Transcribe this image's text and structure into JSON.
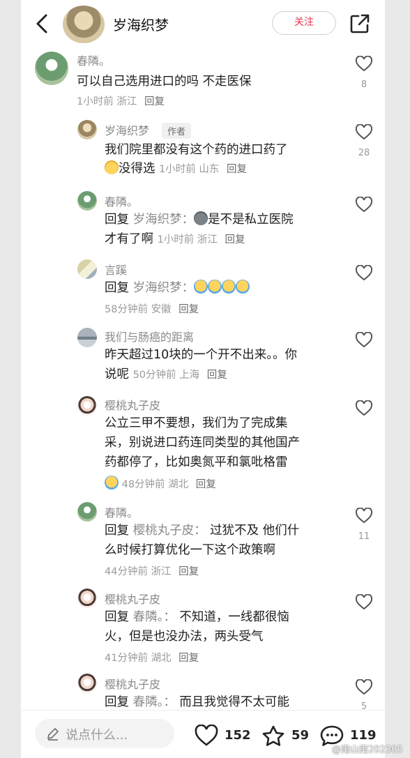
{
  "header": {
    "title": "岁海织梦",
    "follow_label": "关注"
  },
  "comments": [
    {
      "name": "春隣。",
      "text": "可以自己选用进口的吗 不走医保",
      "time": "1小时前",
      "location": "浙江",
      "reply_label": "回复",
      "likes": "8"
    },
    {
      "name": "岁海织梦",
      "author_tag": "作者",
      "text_line1": "我们院里都没有这个药的进口药了",
      "text_line2": "没得选",
      "time": "1小时前",
      "location": "山东",
      "reply_label": "回复",
      "likes": "28"
    },
    {
      "name": "春隣。",
      "reply_prefix": "回复",
      "reply_to": "岁海织梦：",
      "text_line1": "是不是私立医院",
      "text_line2": "才有了啊",
      "time": "1小时前",
      "location": "浙江",
      "reply_label": "回复"
    },
    {
      "name": "言蹊",
      "reply_prefix": "回复",
      "reply_to": "岁海织梦：",
      "time": "58分钟前",
      "location": "安徽",
      "reply_label": "回复"
    },
    {
      "name": "我们与肠癌的距离",
      "text_line1": "昨天超过10块的一个开不出来。。你",
      "text_line2": "说呢",
      "time": "50分钟前",
      "location": "上海",
      "reply_label": "回复"
    },
    {
      "name": "樱桃丸子皮",
      "text_line1": "公立三甲不要想，我们为了完成集",
      "text_line2": "采，别说进口药连同类型的其他国产",
      "text_line3": "药都停了，比如奥氮平和氯吡格雷",
      "time": "48分钟前",
      "location": "湖北",
      "reply_label": "回复"
    },
    {
      "name": "春隣。",
      "reply_prefix": "回复",
      "reply_to": "樱桃丸子皮：",
      "text_line1": "过犹不及 他们什",
      "text_line2": "么时候打算优化一下这个政策啊",
      "time": "44分钟前",
      "location": "浙江",
      "reply_label": "回复",
      "likes": "11"
    },
    {
      "name": "樱桃丸子皮",
      "reply_prefix": "回复",
      "reply_to": "春隣。：",
      "text_line1": "不知道，一线都很恼",
      "text_line2": "火，但是也没办法，两头受气",
      "time": "41分钟前",
      "location": "湖北",
      "reply_label": "回复"
    },
    {
      "name": "樱桃丸子皮",
      "reply_prefix": "回复",
      "reply_to": "春隣。：",
      "text_line1": "而且我觉得不太可能",
      "likes": "5"
    }
  ],
  "bottom_bar": {
    "input_placeholder": "说点什么...",
    "likes": "152",
    "favorites": "59",
    "comments": "119"
  },
  "watermark": "@南山南202305"
}
